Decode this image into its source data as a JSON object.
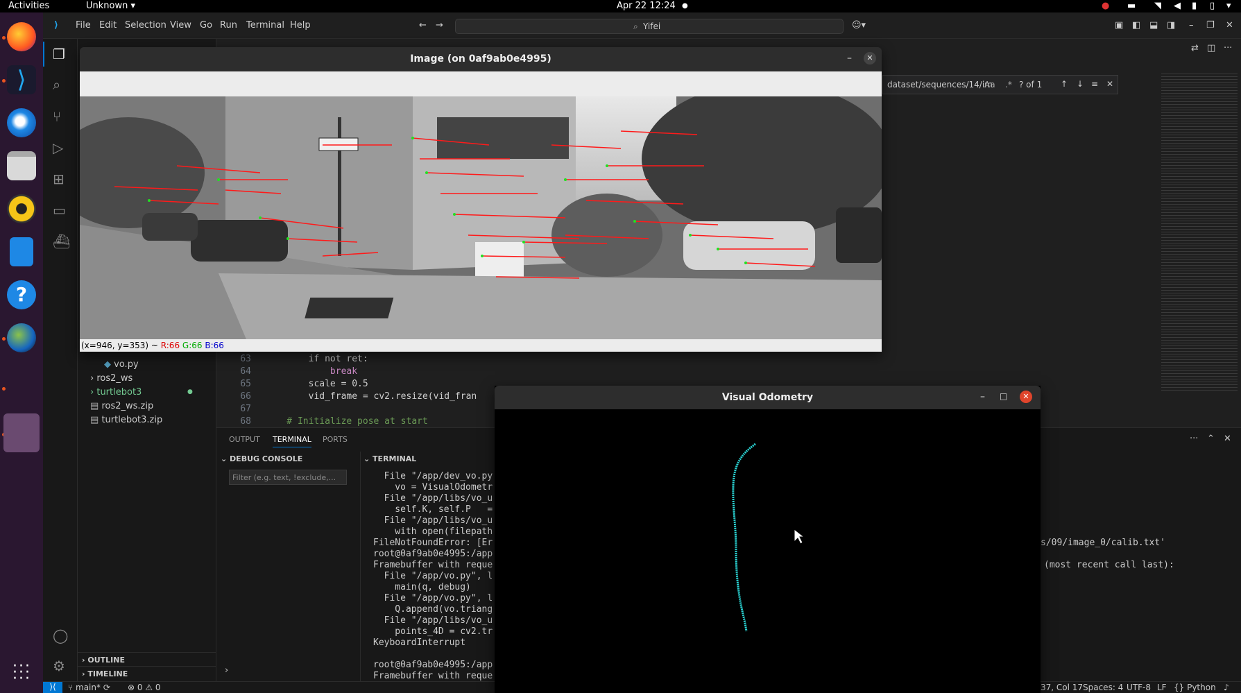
{
  "topbar": {
    "activities": "Activities",
    "app": "Unknown",
    "clock": "Apr 22  12:24"
  },
  "menu": [
    "File",
    "Edit",
    "Selection",
    "View",
    "Go",
    "Run",
    "Terminal",
    "Help"
  ],
  "command_center": "Yifei",
  "find_widget": {
    "query": "dataset/sequences/14/im",
    "count": "? of 1"
  },
  "explorer": {
    "items": [
      {
        "label": "vo.py"
      },
      {
        "label": "ros2_ws"
      },
      {
        "label": "turtlebot3"
      },
      {
        "label": "ros2_ws.zip"
      },
      {
        "label": "turtlebot3.zip"
      }
    ],
    "outline": "OUTLINE",
    "timeline": "TIMELINE"
  },
  "code": {
    "lines": [
      {
        "num": "63",
        "text": "        if not ret:"
      },
      {
        "num": "64",
        "text": "            break"
      },
      {
        "num": "65",
        "text": "        scale = 0.5"
      },
      {
        "num": "66",
        "text": "        vid_frame = cv2.resize(vid_fran"
      },
      {
        "num": "67",
        "text": ""
      },
      {
        "num": "68",
        "text": "    # Initialize pose at start"
      }
    ]
  },
  "panel": {
    "tabs": [
      "OUTPUT",
      "TERMINAL",
      "PORTS"
    ],
    "debug_console": "DEBUG CONSOLE",
    "terminal_label": "TERMINAL",
    "filter_placeholder": "Filter (e.g. text, !exclude,...",
    "terminal_lines": [
      "  File \"/app/dev_vo.py",
      "    vo = VisualOdometr",
      "  File \"/app/libs/vo_u",
      "    self.K, self.P   =",
      "  File \"/app/libs/vo_u",
      "    with open(filepath",
      "FileNotFoundError: [Er",
      "root@0af9ab0e4995:/app",
      "Framebuffer with reque",
      "  File \"/app/vo.py\", l",
      "    main(q, debug)",
      "  File \"/app/vo.py\", l",
      "    Q.append(vo.triang",
      "  File \"/app/libs/vo_u",
      "    points_4D = cv2.tr",
      "KeyboardInterrupt",
      "",
      "root@0af9ab0e4995:/app",
      "Framebuffer with reque"
    ],
    "right_lines": [
      "s/09/image_0/calib.txt'",
      "(most recent call last):"
    ]
  },
  "image_window": {
    "title": "Image (on 0af9ab0e4995)",
    "status_prefix": "(x=946, y=353) ~ ",
    "r": "R:66",
    "g": "G:66",
    "b": "B:66"
  },
  "vo_window": {
    "title": "Visual Odometry"
  },
  "statusbar": {
    "branch": "main*",
    "problems": "⊗ 0 ⚠ 0",
    "position": "37, Col 17",
    "spaces": "Spaces: 4",
    "encoding": "UTF-8",
    "eol": "LF",
    "language": "Python"
  }
}
